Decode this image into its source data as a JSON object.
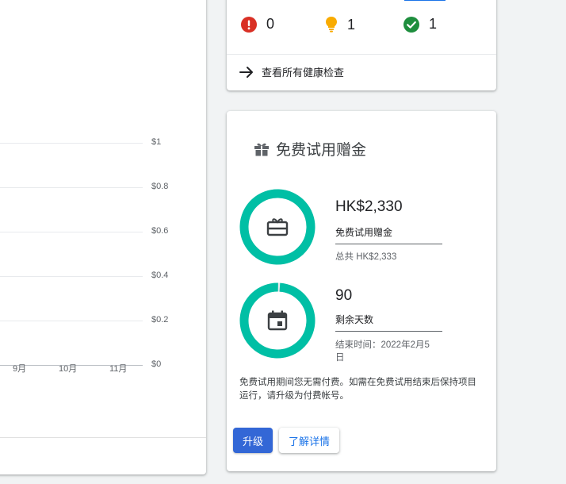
{
  "chart": {
    "y_ticks": [
      "$1",
      "$0.8",
      "$0.6",
      "$0.4",
      "$0.2",
      "$0"
    ],
    "x_ticks": [
      "9月",
      "10月",
      "11月"
    ]
  },
  "chart_data": {
    "type": "line",
    "x": [
      "9月",
      "10月",
      "11月"
    ],
    "series": [],
    "ylim": [
      0,
      1
    ],
    "y_tick_labels": [
      "$1",
      "$0.8",
      "$0.6",
      "$0.4",
      "$0.2",
      "$0"
    ],
    "grid": true
  },
  "health": {
    "error_count": "0",
    "warning_count": "1",
    "ok_count": "1",
    "view_all_label": "查看所有健康检查",
    "colors": {
      "error": "#d93025",
      "warning": "#f9ab00",
      "ok": "#1e8e3e"
    }
  },
  "credit": {
    "title": "免费试用赠金",
    "amount": "HK$2,330",
    "amount_label": "免费试用赠金",
    "amount_total": "总共 HK$2,333",
    "amount_fraction": 0.9987,
    "days": "90",
    "days_label": "剩余天数",
    "end_date": "结束时间：2022年2月5日",
    "days_fraction": 0.99,
    "note": "免费试用期间您无需付费。如需在免费试用结束后保持项目运行，请升级为付费帐号。",
    "upgrade_label": "升级",
    "learn_more_label": "了解详情",
    "ring_color": "#00bfa5"
  }
}
